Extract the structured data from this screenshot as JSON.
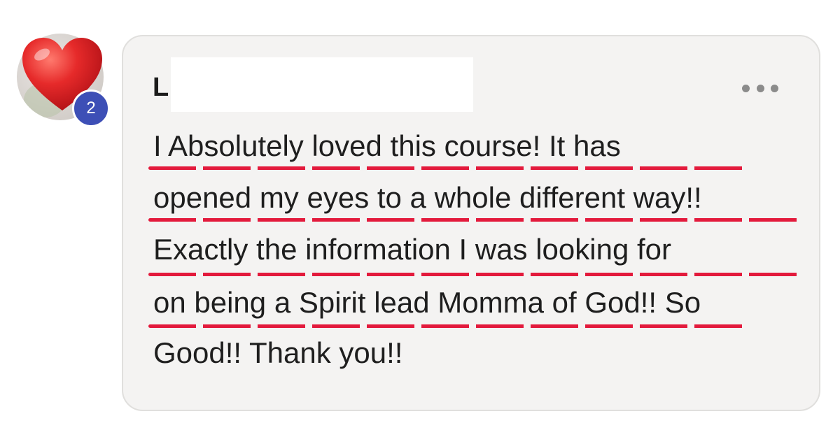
{
  "reaction": {
    "icon": "heart-icon",
    "count": "2",
    "heart_color": "#e62a2a",
    "badge_color": "#3d4fb6"
  },
  "comment": {
    "author_initial": "L",
    "lines": [
      "I Absolutely loved this course! It has",
      "opened my eyes to a whole different way!!",
      "Exactly the information I was looking for",
      "on being a Spirit lead Momma of God!! So",
      "Good!! Thank you!!"
    ],
    "underline_color": "#e31a3c",
    "bubble_color": "#f4f3f2"
  },
  "menu": {
    "icon": "more-options-icon"
  }
}
